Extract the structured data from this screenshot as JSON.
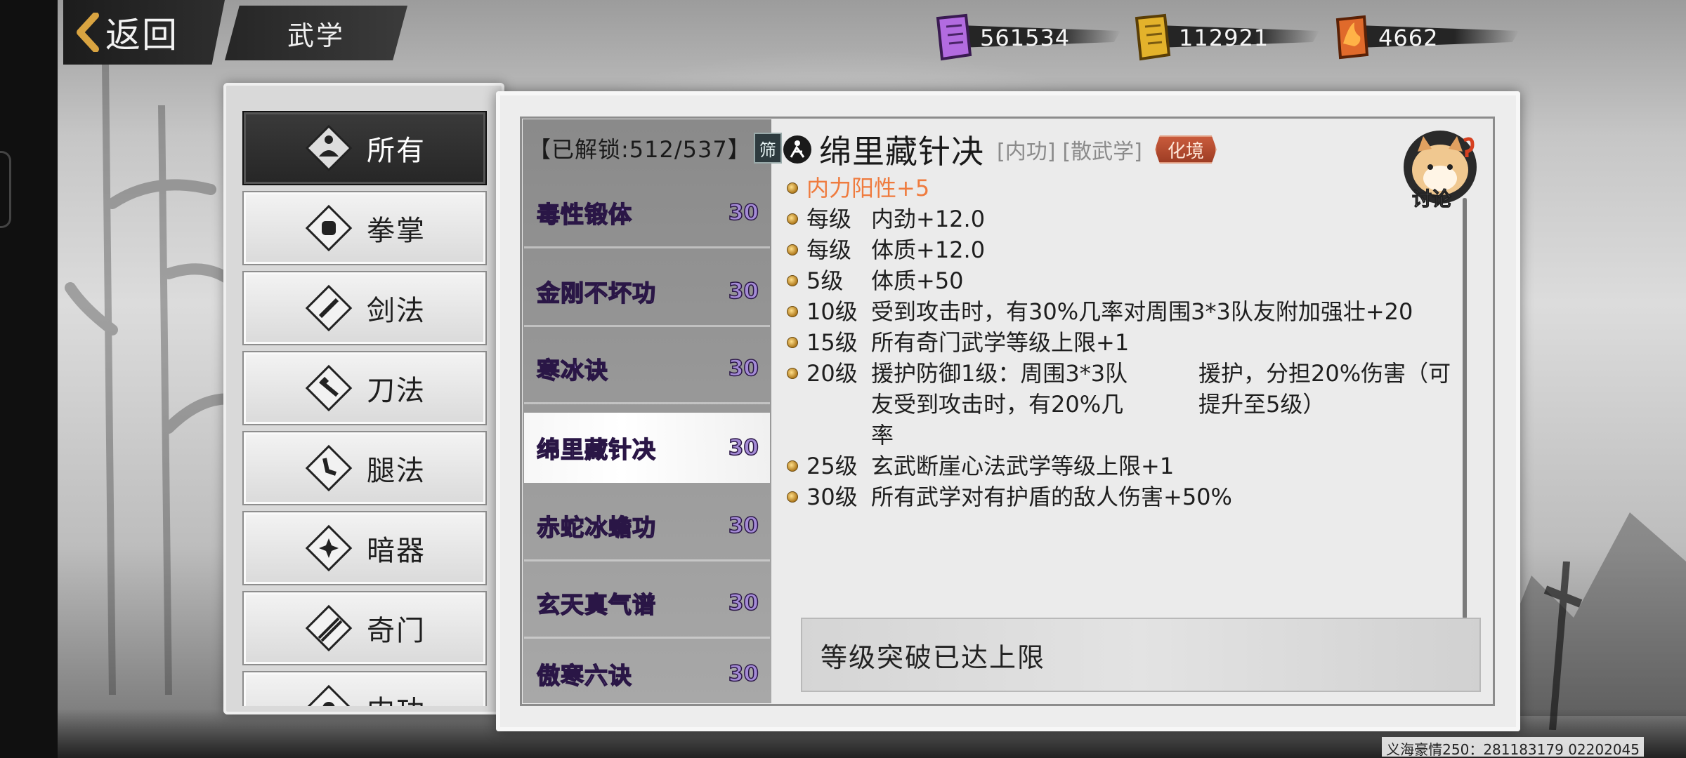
{
  "header": {
    "back_label": "返回",
    "title": "武学"
  },
  "currencies": [
    {
      "icon": "purple-scroll-icon",
      "value": "561534",
      "color": "#b26be0"
    },
    {
      "icon": "gold-scroll-icon",
      "value": "112921",
      "color": "#e3b22b"
    },
    {
      "icon": "flame-scroll-icon",
      "value": "4662",
      "color": "#e06a2b"
    }
  ],
  "categories": [
    {
      "label": "所有",
      "icon": "meditate-icon",
      "active": true
    },
    {
      "label": "拳掌",
      "icon": "fist-icon",
      "active": false
    },
    {
      "label": "剑法",
      "icon": "sword-icon",
      "active": false
    },
    {
      "label": "刀法",
      "icon": "blade-icon",
      "active": false
    },
    {
      "label": "腿法",
      "icon": "kick-icon",
      "active": false
    },
    {
      "label": "暗器",
      "icon": "shuriken-icon",
      "active": false
    },
    {
      "label": "奇门",
      "icon": "staff-icon",
      "active": false
    },
    {
      "label": "内功",
      "icon": "inner-icon",
      "active": false
    }
  ],
  "skill_list": {
    "unlock_text": "【已解锁:512/537】",
    "filter_label": "筛",
    "items": [
      {
        "name": "毒性锻体",
        "level": "30",
        "active": false
      },
      {
        "name": "金刚不坏功",
        "level": "30",
        "active": false
      },
      {
        "name": "寒冰诀",
        "level": "30",
        "active": false
      },
      {
        "name": "绵里藏针决",
        "level": "30",
        "active": true
      },
      {
        "name": "赤蛇冰蟾功",
        "level": "30",
        "active": false
      },
      {
        "name": "玄天真气谱",
        "level": "30",
        "active": false
      },
      {
        "name": "傲寒六诀",
        "level": "30",
        "active": false
      }
    ]
  },
  "detail": {
    "title": "绵里藏针决",
    "tag_type": "[内功]",
    "tag_school": "[散武学]",
    "realm": "化境",
    "discuss_label": "讨论",
    "highlight": "内力阳性+5",
    "effects": [
      {
        "level": "每级",
        "text": "内劲+12.0"
      },
      {
        "level": "每级",
        "text": "体质+12.0"
      },
      {
        "level": "5级",
        "text": "体质+50"
      },
      {
        "level": "10级",
        "text": "受到攻击时，有30%几率对周围3*3队友附加强壮+20"
      },
      {
        "level": "15级",
        "text": "所有奇门武学等级上限+1"
      },
      {
        "level": "20级",
        "text": "援护防御1级：周围3*3队友受到攻击时，有20%几率",
        "text2": "援护，分担20%伤害（可提升至5级）"
      },
      {
        "level": "25级",
        "text": "玄武断崖心法武学等级上限+1"
      },
      {
        "level": "30级",
        "text": "所有武学对有护盾的敌人伤害+50%"
      }
    ],
    "break_status": "等级突破已达上限"
  },
  "watermark": "义海豪情250：281183179  02202045"
}
